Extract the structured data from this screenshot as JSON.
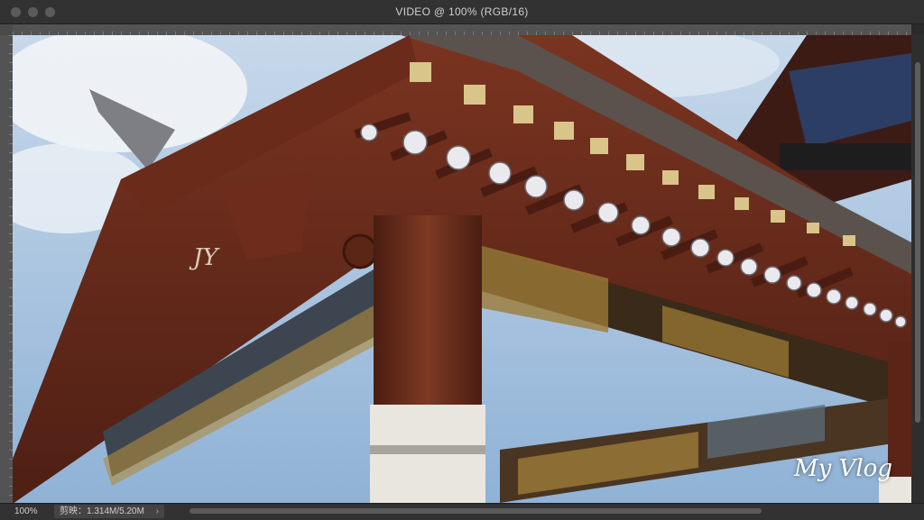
{
  "window": {
    "title": "VIDEO @ 100% (RGB/16)"
  },
  "canvas": {
    "watermark_left": "JY",
    "watermark_right": "My Vlog"
  },
  "status": {
    "zoom": "100%",
    "doc_info": "剪映：1.314M/5.20M",
    "doc_info_chevron": "›"
  },
  "colors": {
    "sky": "#9ab8d8",
    "wood": "#6b2c1c",
    "gold": "#b08a3a"
  }
}
